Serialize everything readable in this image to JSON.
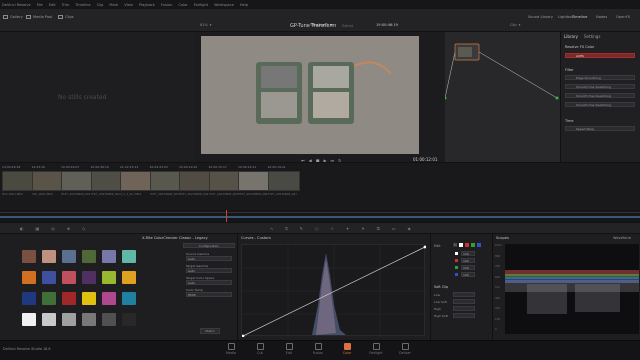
{
  "menubar": {
    "items": [
      "DaVinci Resolve",
      "File",
      "Edit",
      "Trim",
      "Timeline",
      "Clip",
      "Mark",
      "View",
      "Playback",
      "Fusion",
      "Color",
      "Fairlight",
      "Workspace",
      "Help"
    ]
  },
  "toolbar": {
    "left": [
      "Gallery",
      "Media Pool",
      "Clips"
    ],
    "project_title": "GP-Tune Transform",
    "project_status": "Edited",
    "right": [
      "Sound Library",
      "Lightbox",
      "Timeline",
      "Nodes",
      "OpenFX"
    ]
  },
  "viewer": {
    "zoom": "61%",
    "timeline_name": "Timeline 1",
    "source_timecode": "19:00:46:19",
    "clip_mode": "Clip",
    "timecode": "01:00:12:01"
  },
  "gallery": {
    "empty_text": "No stills created"
  },
  "library": {
    "tabs": [
      "Library",
      "Settings"
    ],
    "section_resolve_fx": "Resolve FX Color",
    "color_items": [
      "ACES"
    ],
    "section_filter": "Filter",
    "filter_items": [
      "Edge Smoothing",
      "Smooth Hue Swatching",
      "Smooth Hue Swatching",
      "Smooth Hue Swatching"
    ],
    "section_time": "Time",
    "time_items": [
      "Speed Warp"
    ]
  },
  "clips": [
    {
      "num": "01",
      "tc": "14:00:49:18",
      "name": "DSC-0001.MP4",
      "color": "#4a4a40"
    },
    {
      "num": "02",
      "tc": "14:23:26",
      "name": "DSC_0002.MP4",
      "color": "#5a5448"
    },
    {
      "num": "03",
      "tc": "10:00:46:07",
      "name": "PTZ7_20230808_001",
      "color": "#606058"
    },
    {
      "num": "04",
      "tc": "10:00:46:19",
      "name": "PTZ7_20230808_002",
      "color": "#4e4e46"
    },
    {
      "num": "05",
      "tc": "21:22:10:13",
      "name": "4_2_3_0U..MP4",
      "color": "#706458"
    },
    {
      "num": "06",
      "tc": "10:04:43:03",
      "name": "PTZ7_20230808_003",
      "color": "#58584e"
    },
    {
      "num": "07",
      "tc": "10:04:19:22",
      "name": "PTZ7_20230808_004",
      "color": "#504c44"
    },
    {
      "num": "08",
      "tc": "10:00:15:17",
      "name": "PTZ7_20230808_005",
      "color": "#565248"
    },
    {
      "num": "09",
      "tc": "10:00:16:11",
      "name": "PTZ7_20230808_006",
      "color": "#76746c"
    },
    {
      "num": "10",
      "tc": "10:00:19:21",
      "name": "PTZ7_20230808_007",
      "color": "#4a4a44"
    }
  ],
  "colorchecker": {
    "title": "X-Rite ColorChecker Classic - Legacy",
    "config_title": "Configuration",
    "fields": [
      {
        "label": "Source Gamma",
        "value": "Auto"
      },
      {
        "label": "Target Gamma",
        "value": "Auto"
      },
      {
        "label": "Target Color Space",
        "value": "Auto"
      },
      {
        "label": "Color Temp",
        "value": "6500"
      }
    ],
    "match_label": "Match",
    "swatches": [
      "#7a5040",
      "#c09080",
      "#5a7090",
      "#506838",
      "#7878a8",
      "#60b8a8",
      "#d07020",
      "#4050a0",
      "#c05060",
      "#503060",
      "#98b830",
      "#e0a020",
      "#203880",
      "#407038",
      "#a02828",
      "#e0c010",
      "#b04890",
      "#2080a0",
      "#f0f0f0",
      "#c8c8c8",
      "#a0a0a0",
      "#787878",
      "#505050",
      "#282828"
    ]
  },
  "curves": {
    "title": "Curves - Custom",
    "edit_label": "Edit",
    "channel_values": [
      "100",
      "100",
      "100",
      "100"
    ],
    "soft_clip_label": "Soft Clip",
    "soft_clip_fields": [
      "Low",
      "Low Soft",
      "High",
      "High Soft"
    ]
  },
  "scopes": {
    "title": "Scopes",
    "mode": "Waveform",
    "scale": [
      "1023",
      "896",
      "768",
      "640",
      "512",
      "384",
      "256",
      "128",
      "0"
    ]
  },
  "pages": [
    "Media",
    "Cut",
    "Edit",
    "Fusion",
    "Color",
    "Fairlight",
    "Deliver"
  ],
  "active_page": "Color",
  "app_version": "DaVinci Resolve Studio 18.6",
  "colors": {
    "accent": "#e07040",
    "playhead": "#d04040"
  }
}
